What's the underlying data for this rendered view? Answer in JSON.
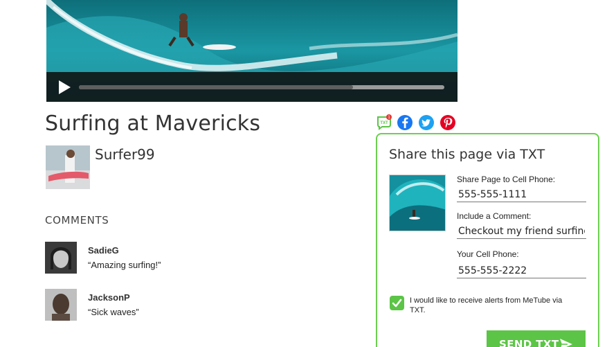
{
  "video": {
    "title": "Surfing at Mavericks",
    "progress_fraction": 0.75,
    "author": "Surfer99"
  },
  "comments": {
    "heading": "COMMENTS",
    "items": [
      {
        "user": "SadieG",
        "text": "“Amazing surfing!”"
      },
      {
        "user": "JacksonP",
        "text": "“Sick waves”"
      }
    ]
  },
  "share_icons": [
    {
      "name": "metube-txt-icon",
      "badge": "1",
      "color": "#5cc446"
    },
    {
      "name": "facebook-icon",
      "color": "#1877f2"
    },
    {
      "name": "twitter-icon",
      "color": "#1da1f2"
    },
    {
      "name": "pinterest-icon",
      "color": "#e60023"
    }
  ],
  "share_panel": {
    "heading": "Share this page via TXT",
    "cell_label": "Share Page to Cell Phone:",
    "cell_value": "555-555-1111",
    "comment_label": "Include a Comment:",
    "comment_value": "Checkout my friend surfing",
    "your_cell_label": "Your Cell Phone:",
    "your_cell_value": "555-555-2222",
    "alerts_checked": true,
    "alerts_text": "I would like to receive alerts from MeTube via TXT.",
    "send_label": "SEND TXT"
  },
  "colors": {
    "accent_green": "#5cc446",
    "panel_border": "#6bd04f",
    "controls_bg": "#0f0f0f"
  }
}
